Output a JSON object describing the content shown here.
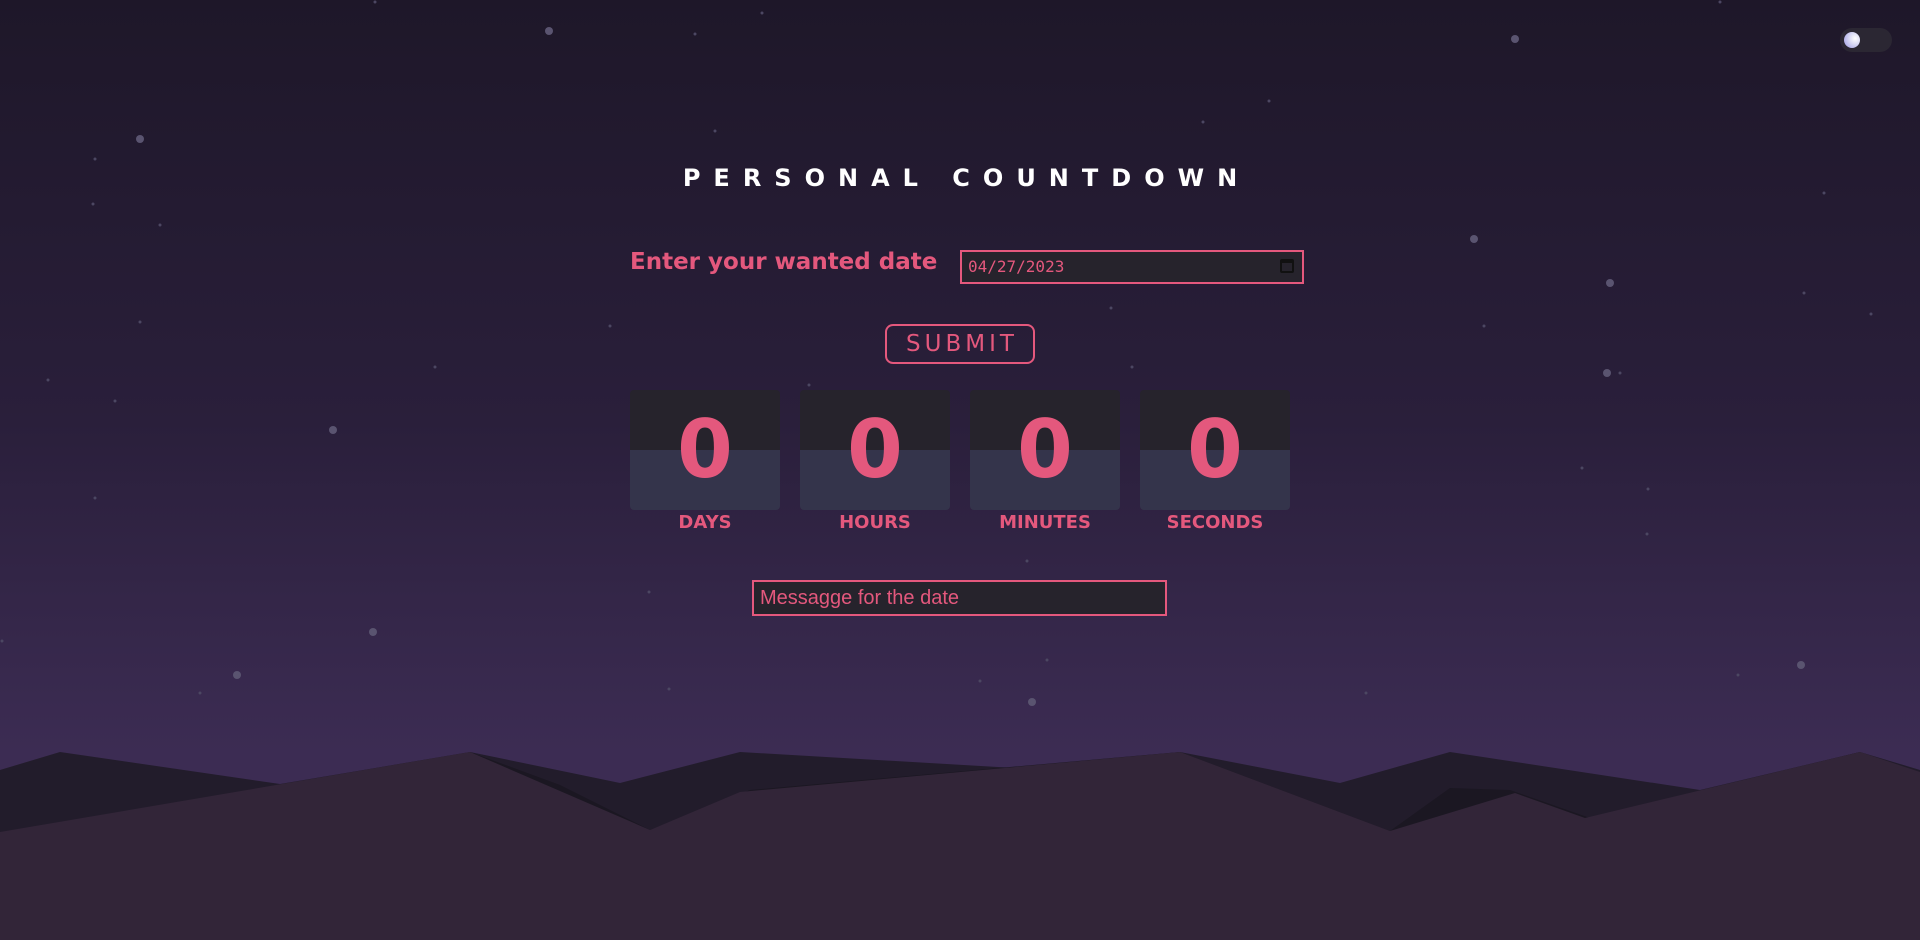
{
  "header": {
    "title": "PERSONAL COUNTDOWN",
    "theme_toggle_icon": "moon-toggle-icon"
  },
  "form": {
    "date_label": "Enter your wanted date",
    "date_value": "04/27/2023",
    "date_icon": "calendar-icon",
    "submit_label": "SUBMIT"
  },
  "countdown": [
    {
      "value": "0",
      "unit": "DAYS"
    },
    {
      "value": "0",
      "unit": "HOURS"
    },
    {
      "value": "0",
      "unit": "MINUTES"
    },
    {
      "value": "0",
      "unit": "SECONDS"
    }
  ],
  "message": {
    "placeholder": "Messagge for the date"
  },
  "colors": {
    "accent": "#e4587d",
    "card_top": "#26232c",
    "card_bottom": "#34344b",
    "sky_top": "#1e1729",
    "sky_bottom": "#3c2c53"
  }
}
